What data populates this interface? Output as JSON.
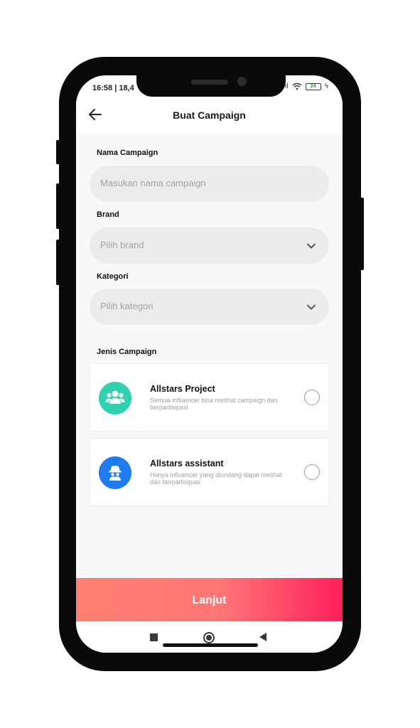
{
  "status": {
    "time": "16:58 | 18,4",
    "battery": "24"
  },
  "header": {
    "title": "Buat Campaign"
  },
  "form": {
    "name": {
      "label": "Nama Campaign",
      "placeholder": "Masukan nama campaign"
    },
    "brand": {
      "label": "Brand",
      "placeholder": "Pilih brand"
    },
    "category": {
      "label": "Kategori",
      "placeholder": "Pilih kategori"
    }
  },
  "campaign_type": {
    "label": "Jenis Campaign",
    "options": [
      {
        "title": "Allstars Project",
        "desc": "Semua influencer bisa melihat campaign dan berpartisipasi",
        "color": "#2fd1b2",
        "icon": "group-icon"
      },
      {
        "title": "Allstars assistant",
        "desc": "Hanya influencer yang diundang dapat melihat dan berpartisipasi",
        "color": "#1e7bf0",
        "icon": "spy-icon"
      }
    ]
  },
  "footer": {
    "cta": "Lanjut"
  },
  "colors": {
    "cta_start": "#ff8070",
    "cta_end": "#ff1f5a"
  }
}
